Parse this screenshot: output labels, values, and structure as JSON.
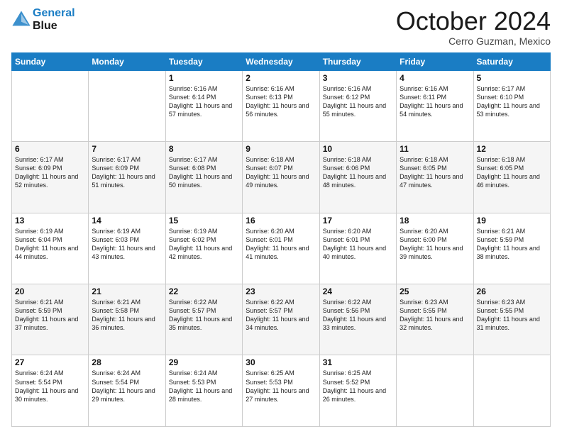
{
  "logo": {
    "line1": "General",
    "line2": "Blue"
  },
  "title": "October 2024",
  "location": "Cerro Guzman, Mexico",
  "days_of_week": [
    "Sunday",
    "Monday",
    "Tuesday",
    "Wednesday",
    "Thursday",
    "Friday",
    "Saturday"
  ],
  "weeks": [
    [
      {
        "day": "",
        "sunrise": "",
        "sunset": "",
        "daylight": ""
      },
      {
        "day": "",
        "sunrise": "",
        "sunset": "",
        "daylight": ""
      },
      {
        "day": "1",
        "sunrise": "Sunrise: 6:16 AM",
        "sunset": "Sunset: 6:14 PM",
        "daylight": "Daylight: 11 hours and 57 minutes."
      },
      {
        "day": "2",
        "sunrise": "Sunrise: 6:16 AM",
        "sunset": "Sunset: 6:13 PM",
        "daylight": "Daylight: 11 hours and 56 minutes."
      },
      {
        "day": "3",
        "sunrise": "Sunrise: 6:16 AM",
        "sunset": "Sunset: 6:12 PM",
        "daylight": "Daylight: 11 hours and 55 minutes."
      },
      {
        "day": "4",
        "sunrise": "Sunrise: 6:16 AM",
        "sunset": "Sunset: 6:11 PM",
        "daylight": "Daylight: 11 hours and 54 minutes."
      },
      {
        "day": "5",
        "sunrise": "Sunrise: 6:17 AM",
        "sunset": "Sunset: 6:10 PM",
        "daylight": "Daylight: 11 hours and 53 minutes."
      }
    ],
    [
      {
        "day": "6",
        "sunrise": "Sunrise: 6:17 AM",
        "sunset": "Sunset: 6:09 PM",
        "daylight": "Daylight: 11 hours and 52 minutes."
      },
      {
        "day": "7",
        "sunrise": "Sunrise: 6:17 AM",
        "sunset": "Sunset: 6:09 PM",
        "daylight": "Daylight: 11 hours and 51 minutes."
      },
      {
        "day": "8",
        "sunrise": "Sunrise: 6:17 AM",
        "sunset": "Sunset: 6:08 PM",
        "daylight": "Daylight: 11 hours and 50 minutes."
      },
      {
        "day": "9",
        "sunrise": "Sunrise: 6:18 AM",
        "sunset": "Sunset: 6:07 PM",
        "daylight": "Daylight: 11 hours and 49 minutes."
      },
      {
        "day": "10",
        "sunrise": "Sunrise: 6:18 AM",
        "sunset": "Sunset: 6:06 PM",
        "daylight": "Daylight: 11 hours and 48 minutes."
      },
      {
        "day": "11",
        "sunrise": "Sunrise: 6:18 AM",
        "sunset": "Sunset: 6:05 PM",
        "daylight": "Daylight: 11 hours and 47 minutes."
      },
      {
        "day": "12",
        "sunrise": "Sunrise: 6:18 AM",
        "sunset": "Sunset: 6:05 PM",
        "daylight": "Daylight: 11 hours and 46 minutes."
      }
    ],
    [
      {
        "day": "13",
        "sunrise": "Sunrise: 6:19 AM",
        "sunset": "Sunset: 6:04 PM",
        "daylight": "Daylight: 11 hours and 44 minutes."
      },
      {
        "day": "14",
        "sunrise": "Sunrise: 6:19 AM",
        "sunset": "Sunset: 6:03 PM",
        "daylight": "Daylight: 11 hours and 43 minutes."
      },
      {
        "day": "15",
        "sunrise": "Sunrise: 6:19 AM",
        "sunset": "Sunset: 6:02 PM",
        "daylight": "Daylight: 11 hours and 42 minutes."
      },
      {
        "day": "16",
        "sunrise": "Sunrise: 6:20 AM",
        "sunset": "Sunset: 6:01 PM",
        "daylight": "Daylight: 11 hours and 41 minutes."
      },
      {
        "day": "17",
        "sunrise": "Sunrise: 6:20 AM",
        "sunset": "Sunset: 6:01 PM",
        "daylight": "Daylight: 11 hours and 40 minutes."
      },
      {
        "day": "18",
        "sunrise": "Sunrise: 6:20 AM",
        "sunset": "Sunset: 6:00 PM",
        "daylight": "Daylight: 11 hours and 39 minutes."
      },
      {
        "day": "19",
        "sunrise": "Sunrise: 6:21 AM",
        "sunset": "Sunset: 5:59 PM",
        "daylight": "Daylight: 11 hours and 38 minutes."
      }
    ],
    [
      {
        "day": "20",
        "sunrise": "Sunrise: 6:21 AM",
        "sunset": "Sunset: 5:59 PM",
        "daylight": "Daylight: 11 hours and 37 minutes."
      },
      {
        "day": "21",
        "sunrise": "Sunrise: 6:21 AM",
        "sunset": "Sunset: 5:58 PM",
        "daylight": "Daylight: 11 hours and 36 minutes."
      },
      {
        "day": "22",
        "sunrise": "Sunrise: 6:22 AM",
        "sunset": "Sunset: 5:57 PM",
        "daylight": "Daylight: 11 hours and 35 minutes."
      },
      {
        "day": "23",
        "sunrise": "Sunrise: 6:22 AM",
        "sunset": "Sunset: 5:57 PM",
        "daylight": "Daylight: 11 hours and 34 minutes."
      },
      {
        "day": "24",
        "sunrise": "Sunrise: 6:22 AM",
        "sunset": "Sunset: 5:56 PM",
        "daylight": "Daylight: 11 hours and 33 minutes."
      },
      {
        "day": "25",
        "sunrise": "Sunrise: 6:23 AM",
        "sunset": "Sunset: 5:55 PM",
        "daylight": "Daylight: 11 hours and 32 minutes."
      },
      {
        "day": "26",
        "sunrise": "Sunrise: 6:23 AM",
        "sunset": "Sunset: 5:55 PM",
        "daylight": "Daylight: 11 hours and 31 minutes."
      }
    ],
    [
      {
        "day": "27",
        "sunrise": "Sunrise: 6:24 AM",
        "sunset": "Sunset: 5:54 PM",
        "daylight": "Daylight: 11 hours and 30 minutes."
      },
      {
        "day": "28",
        "sunrise": "Sunrise: 6:24 AM",
        "sunset": "Sunset: 5:54 PM",
        "daylight": "Daylight: 11 hours and 29 minutes."
      },
      {
        "day": "29",
        "sunrise": "Sunrise: 6:24 AM",
        "sunset": "Sunset: 5:53 PM",
        "daylight": "Daylight: 11 hours and 28 minutes."
      },
      {
        "day": "30",
        "sunrise": "Sunrise: 6:25 AM",
        "sunset": "Sunset: 5:53 PM",
        "daylight": "Daylight: 11 hours and 27 minutes."
      },
      {
        "day": "31",
        "sunrise": "Sunrise: 6:25 AM",
        "sunset": "Sunset: 5:52 PM",
        "daylight": "Daylight: 11 hours and 26 minutes."
      },
      {
        "day": "",
        "sunrise": "",
        "sunset": "",
        "daylight": ""
      },
      {
        "day": "",
        "sunrise": "",
        "sunset": "",
        "daylight": ""
      }
    ]
  ]
}
